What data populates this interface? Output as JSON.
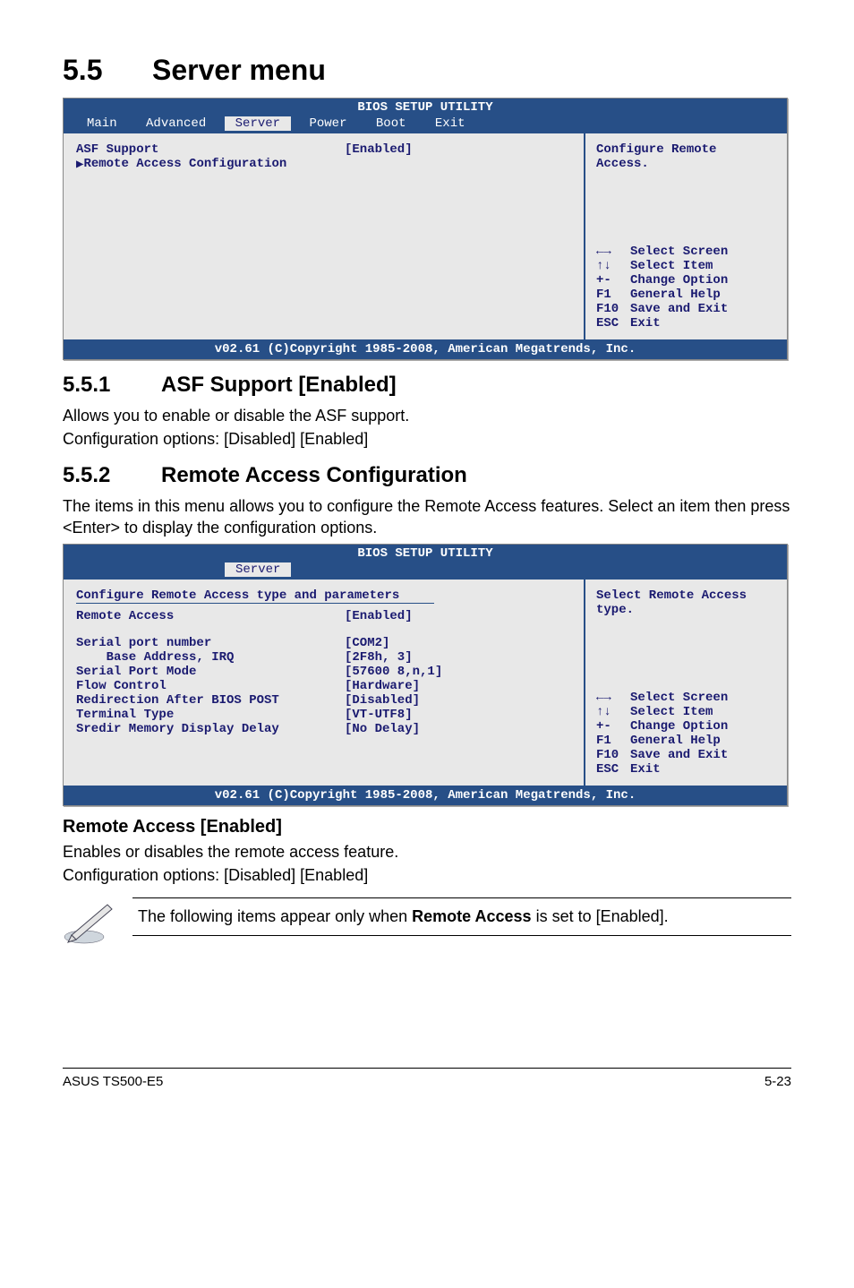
{
  "page": {
    "section_num": "5.5",
    "section_title": "Server menu",
    "footer_left": "ASUS TS500-E5",
    "footer_right": "5-23"
  },
  "bios1": {
    "title": "BIOS SETUP UTILITY",
    "tabs": {
      "t1": "Main",
      "t2": "Advanced",
      "t3": "Server",
      "t4": "Power",
      "t5": "Boot",
      "t6": "Exit"
    },
    "rows": {
      "asf_label": "ASF Support",
      "asf_val": "[Enabled]",
      "remote_cfg": "Remote Access Configuration"
    },
    "help_top": "Configure Remote Access.",
    "help": {
      "l1k": "←→",
      "l1v": "Select Screen",
      "l2k": "↑↓",
      "l2v": "Select Item",
      "l3k": "+-",
      "l3v": "Change Option",
      "l4k": "F1",
      "l4v": "General Help",
      "l5k": "F10",
      "l5v": "Save and Exit",
      "l6k": "ESC",
      "l6v": "Exit"
    },
    "footer": "v02.61 (C)Copyright 1985-2008, American Megatrends, Inc."
  },
  "s551": {
    "num": "5.5.1",
    "title": "ASF Support [Enabled]",
    "p1": "Allows you to enable or disable the ASF support.",
    "p2": "Configuration options: [Disabled] [Enabled]"
  },
  "s552": {
    "num": "5.5.2",
    "title": "Remote Access Configuration",
    "p1": "The items in this menu allows you to configure the Remote Access features. Select an item then press <Enter> to display the configuration options."
  },
  "bios2": {
    "title": "BIOS SETUP UTILITY",
    "tab": "Server",
    "heading": "Configure Remote Access type and parameters",
    "rows": {
      "r0l": "Remote Access",
      "r0v": "[Enabled]",
      "r1l": "Serial port number",
      "r1v": "[COM2]",
      "r2l": "    Base Address, IRQ",
      "r2v": "[2F8h, 3]",
      "r3l": "Serial Port Mode",
      "r3v": "[57600 8,n,1]",
      "r4l": "Flow Control",
      "r4v": "[Hardware]",
      "r5l": "Redirection After BIOS POST",
      "r5v": "[Disabled]",
      "r6l": "Terminal Type",
      "r6v": "[VT-UTF8]",
      "r7l": "Sredir Memory Display Delay",
      "r7v": "[No Delay]"
    },
    "help_top": "Select Remote Access type.",
    "help": {
      "l1k": "←→",
      "l1v": "Select Screen",
      "l2k": "↑↓",
      "l2v": "Select Item",
      "l3k": "+-",
      "l3v": "Change Option",
      "l4k": "F1",
      "l4v": "General Help",
      "l5k": "F10",
      "l5v": "Save and Exit",
      "l6k": "ESC",
      "l6v": "Exit"
    },
    "footer": "v02.61 (C)Copyright 1985-2008, American Megatrends, Inc."
  },
  "remote_access": {
    "heading": "Remote Access [Enabled]",
    "p1": "Enables or disables the remote access feature.",
    "p2": "Configuration options: [Disabled] [Enabled]"
  },
  "note": {
    "text_a": "The following items appear only when ",
    "text_bold": "Remote Access",
    "text_b": " is set to [Enabled]."
  }
}
